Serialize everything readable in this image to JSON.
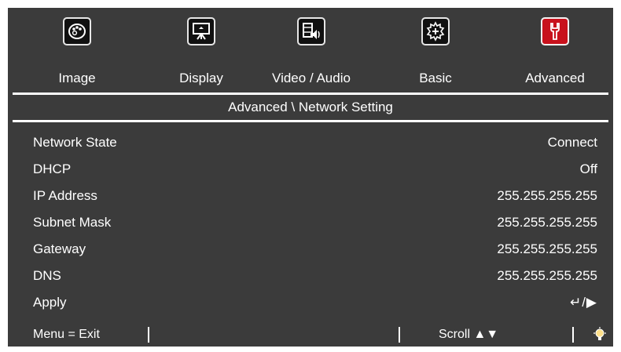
{
  "tabs": [
    {
      "label": "Image",
      "icon": "palette-icon",
      "active": false
    },
    {
      "label": "Display",
      "icon": "projection-screen-icon",
      "active": false
    },
    {
      "label": "Video / Audio",
      "icon": "video-audio-icon",
      "active": false
    },
    {
      "label": "Basic",
      "icon": "gear-icon",
      "active": false
    },
    {
      "label": "Advanced",
      "icon": "wrench-icon",
      "active": true
    }
  ],
  "section_title": "Advanced \\ Network Setting",
  "rows": [
    {
      "label": "Network State",
      "value": "Connect"
    },
    {
      "label": "DHCP",
      "value": "Off"
    },
    {
      "label": "IP Address",
      "value": "255.255.255.255"
    },
    {
      "label": "Subnet Mask",
      "value": "255.255.255.255"
    },
    {
      "label": "Gateway",
      "value": "255.255.255.255"
    },
    {
      "label": "DNS",
      "value": "255.255.255.255"
    },
    {
      "label": "Apply",
      "value": "↵/▶"
    }
  ],
  "footer": {
    "menu_hint": "Menu = Exit",
    "scroll_label": "Scroll",
    "scroll_arrows": "▲▼",
    "bulb_icon": "lightbulb-icon"
  },
  "colors": {
    "background": "#3b3b3b",
    "active_tab": "#c8111c",
    "text": "#ffffff"
  }
}
